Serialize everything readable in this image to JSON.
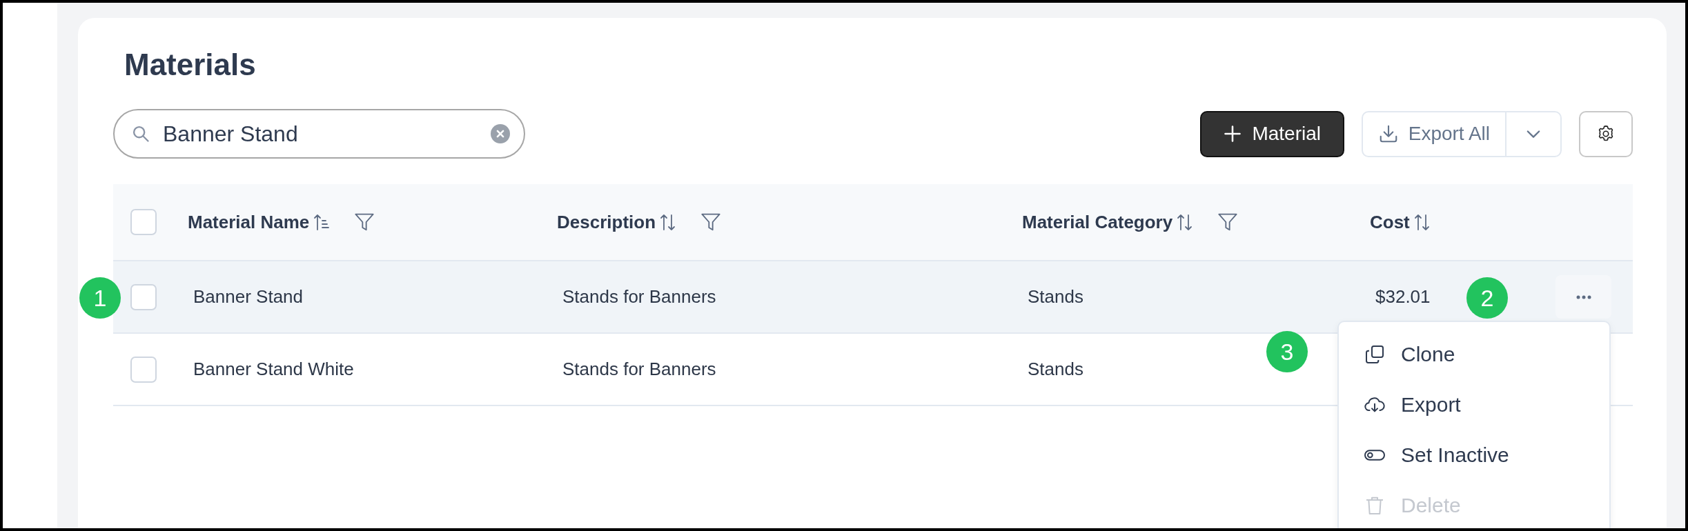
{
  "page": {
    "title": "Materials"
  },
  "search": {
    "value": "Banner Stand"
  },
  "toolbar": {
    "add_button": "Material",
    "export_button": "Export All"
  },
  "table": {
    "select_all": {
      "checked": false
    },
    "columns": [
      {
        "label": "Material Name",
        "sorted": true,
        "filter": true
      },
      {
        "label": "Description",
        "sorted": false,
        "filter": true
      },
      {
        "label": "Material Category",
        "sorted": false,
        "filter": true
      },
      {
        "label": "Cost",
        "sorted": false,
        "filter": false
      }
    ],
    "rows": [
      {
        "cells": [
          "Banner Stand",
          "Stands for Banners",
          "Stands",
          "$32.01"
        ],
        "checked": false,
        "highlighted": true,
        "actions": true
      },
      {
        "cells": [
          "Banner Stand White",
          "Stands for Banners",
          "Stands",
          ""
        ],
        "checked": false,
        "highlighted": false,
        "actions": false
      }
    ]
  },
  "row_menu": [
    {
      "label": "Clone",
      "disabled": false
    },
    {
      "label": "Export",
      "disabled": false
    },
    {
      "label": "Set Inactive",
      "disabled": false
    },
    {
      "label": "Delete",
      "disabled": true
    }
  ],
  "markers": [
    {
      "label": "1"
    },
    {
      "label": "2"
    },
    {
      "label": "3"
    }
  ]
}
